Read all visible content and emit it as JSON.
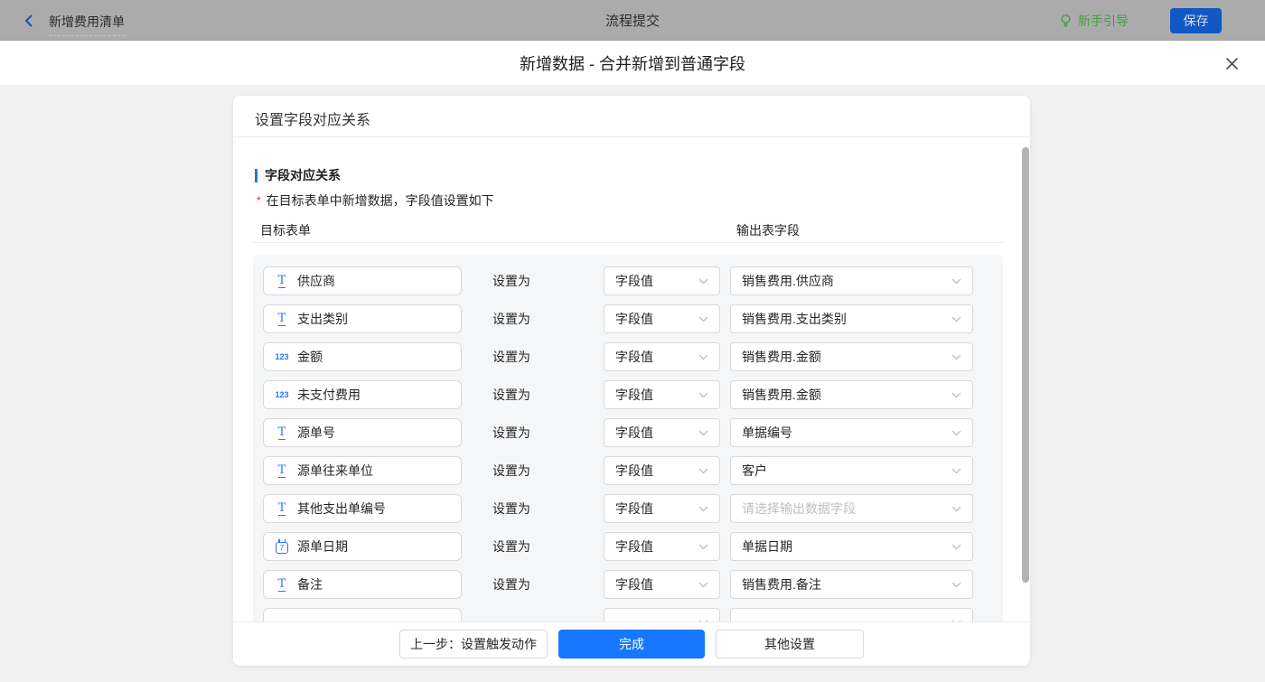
{
  "topbar": {
    "back_label": "新增费用清单",
    "center_title": "流程提交",
    "guide_label": "新手引导",
    "save_label": "保存"
  },
  "modal": {
    "title": "新增数据 - 合并新增到普通字段",
    "panel_title": "设置字段对应关系",
    "section_title": "字段对应关系",
    "required_mark": "*",
    "section_hint": "在目标表单中新增数据，字段值设置如下",
    "columns": {
      "left": "目标表单",
      "right": "输出表字段"
    },
    "set_as_label": "设置为",
    "rows": [
      {
        "icon": "text",
        "field": "供应商",
        "mode": "字段值",
        "output": "销售费用.供应商",
        "placeholder": false
      },
      {
        "icon": "text",
        "field": "支出类别",
        "mode": "字段值",
        "output": "销售费用.支出类别",
        "placeholder": false
      },
      {
        "icon": "number",
        "field": "金额",
        "mode": "字段值",
        "output": "销售费用.金额",
        "placeholder": false
      },
      {
        "icon": "number",
        "field": "未支付费用",
        "mode": "字段值",
        "output": "销售费用.金额",
        "placeholder": false
      },
      {
        "icon": "text",
        "field": "源单号",
        "mode": "字段值",
        "output": "单据编号",
        "placeholder": false
      },
      {
        "icon": "text",
        "field": "源单往来单位",
        "mode": "字段值",
        "output": "客户",
        "placeholder": false
      },
      {
        "icon": "text",
        "field": "其他支出单编号",
        "mode": "字段值",
        "output": "请选择输出数据字段",
        "placeholder": true
      },
      {
        "icon": "date",
        "field": "源单日期",
        "mode": "字段值",
        "output": "单据日期",
        "placeholder": false
      },
      {
        "icon": "text",
        "field": "备注",
        "mode": "字段值",
        "output": "销售费用.备注",
        "placeholder": false
      },
      {
        "icon": "none",
        "field": "",
        "mode": "",
        "output": "",
        "placeholder": false
      }
    ],
    "footer": {
      "prev_label": "上一步：设置触发动作",
      "done_label": "完成",
      "other_label": "其他设置"
    }
  },
  "icons": {
    "back": "chevron-left",
    "guide": "lightbulb",
    "close": "x",
    "field_text": "T",
    "field_number": "123",
    "field_date": "calendar-7",
    "select": "chevron-down"
  },
  "colors": {
    "accent_blue": "#1677ff",
    "field_icon_blue": "#3370ff",
    "save_button_blue": "#1157c5",
    "guide_green": "#3fa33c",
    "required_red": "#f5222d",
    "topbar_bg": "#ababab",
    "page_bg": "#f1f1f2",
    "rows_bg": "#f5f6f7",
    "scrollbar": "#b3b3b3"
  }
}
